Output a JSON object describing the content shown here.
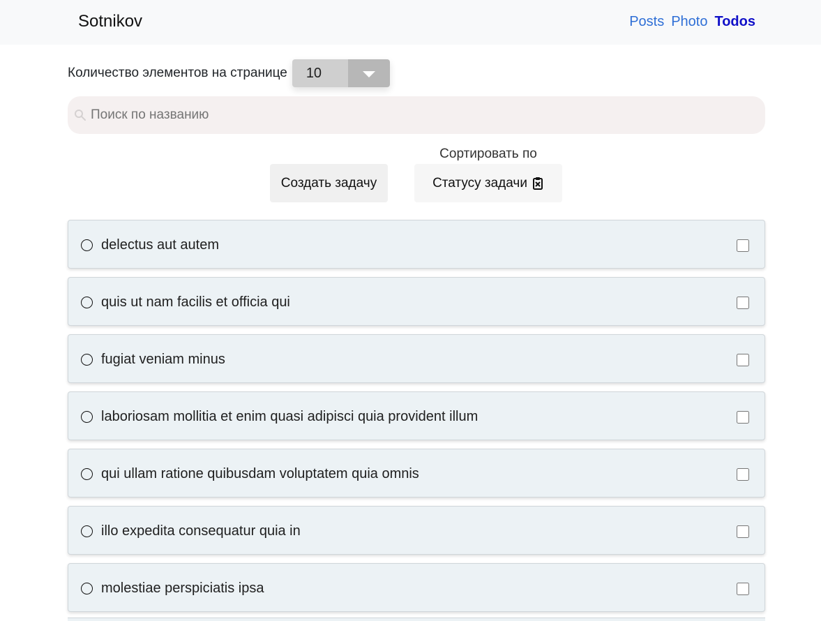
{
  "header": {
    "brand": "Sotnikov",
    "nav_links": [
      {
        "label": "Posts",
        "active": false
      },
      {
        "label": "Photo",
        "active": false
      },
      {
        "label": "Todos",
        "active": true
      }
    ]
  },
  "controls": {
    "page_size_label": "Количество элементов на странице",
    "page_size_value": "10",
    "search_placeholder": "Поиск по названию",
    "sort_label": "Сортировать по",
    "create_button_label": "Создать задачу",
    "sort_button_label": "Статусу задачи"
  },
  "todos": [
    {
      "title": "delectus aut autem",
      "checked": false
    },
    {
      "title": "quis ut nam facilis et officia qui",
      "checked": false
    },
    {
      "title": "fugiat veniam minus",
      "checked": false
    },
    {
      "title": "laboriosam mollitia et enim quasi adipisci quia provident illum",
      "checked": false
    },
    {
      "title": "qui ullam ratione quibusdam voluptatem quia omnis",
      "checked": false
    },
    {
      "title": "illo expedita consequatur quia in",
      "checked": false
    },
    {
      "title": "molestiae perspiciatis ipsa",
      "checked": false
    }
  ],
  "colors": {
    "nav_background": "#f8f9fa",
    "nav_link": "#2f6fd6",
    "nav_active": "#1010c8",
    "todo_background": "#ecf2f5",
    "search_background": "#f5f0f0"
  },
  "icons": {
    "search": "search-icon",
    "select": "chevron-down-icon",
    "sort": "clipboard-x-icon",
    "todo_status": "circle-icon"
  }
}
